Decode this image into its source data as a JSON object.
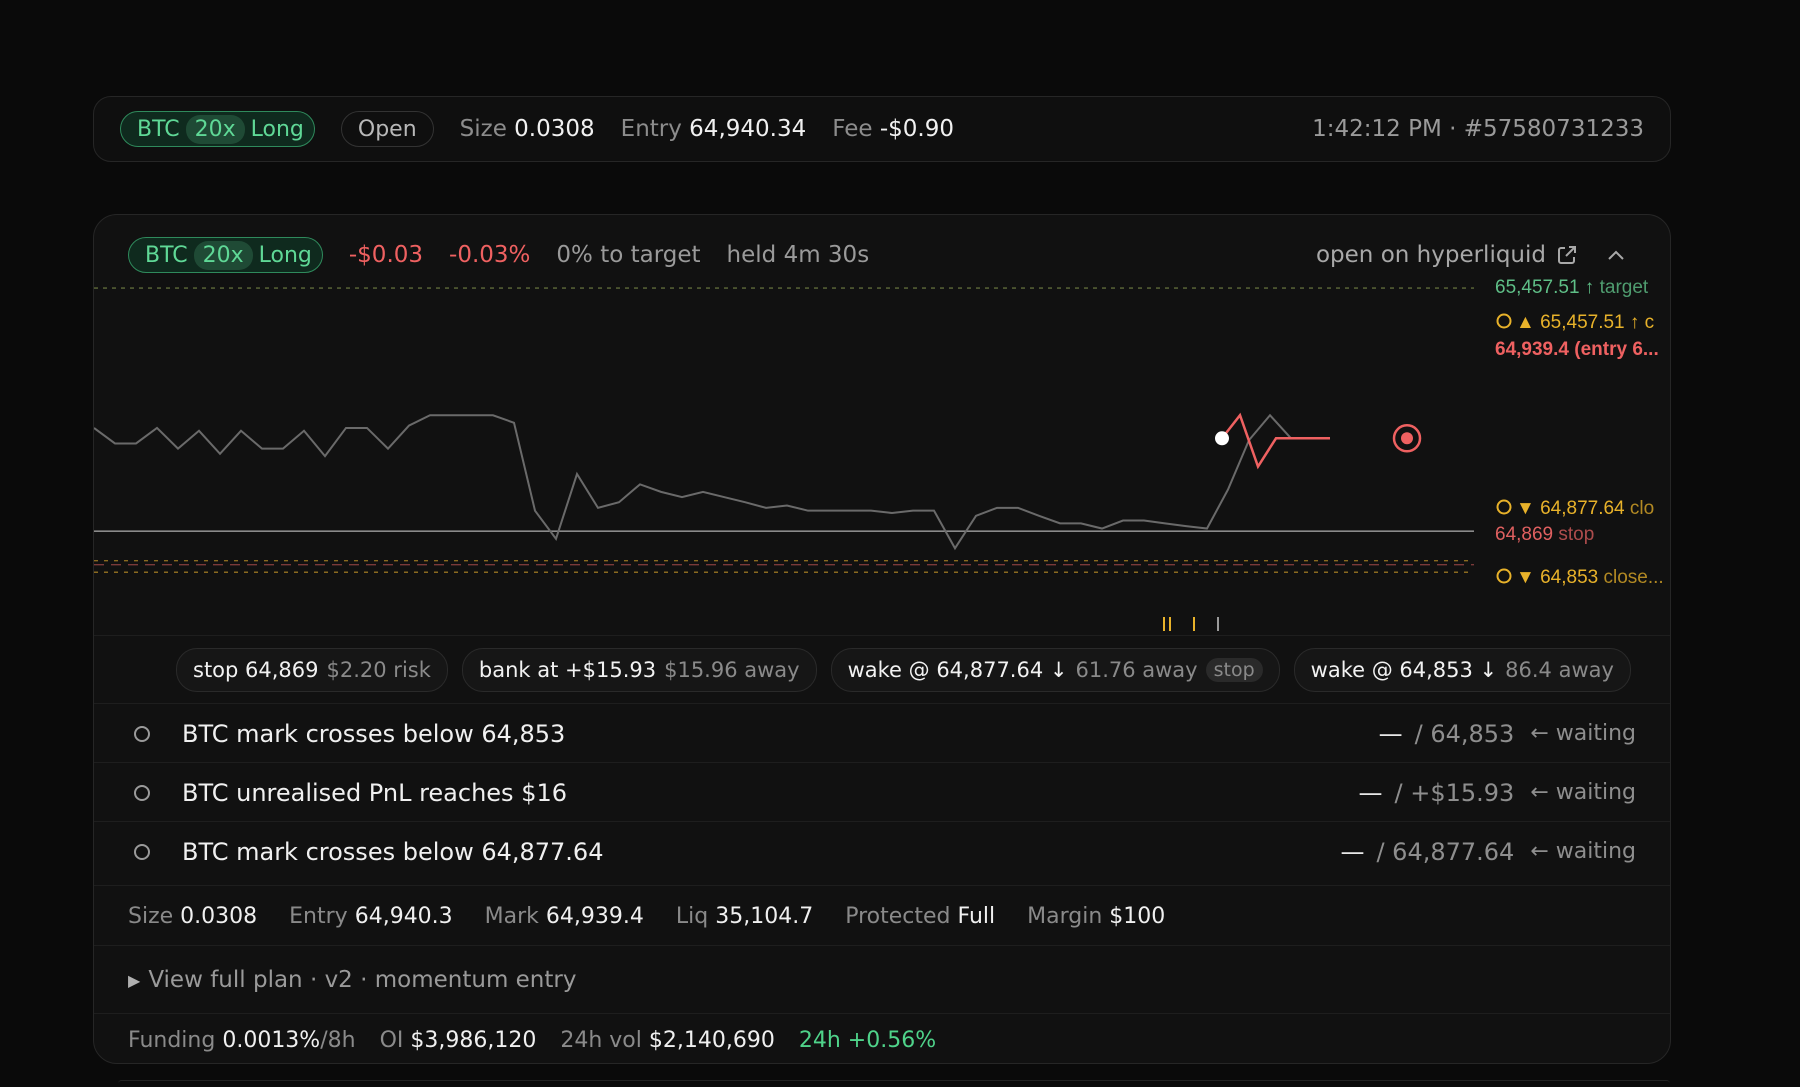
{
  "colors": {
    "long_green": "#5fd896",
    "loss_red": "#ef6161",
    "target_green": "#5fbf87",
    "alert_yellow": "#e8b22a",
    "stop_red": "#e06060",
    "price_line": "#6a6a6a"
  },
  "header": {
    "asset": "BTC",
    "leverage": "20x",
    "side": "Long",
    "status": "Open",
    "size_label": "Size",
    "size_value": "0.0308",
    "entry_label": "Entry",
    "entry_value": "64,940.34",
    "fee_label": "Fee",
    "fee_value": "-$0.90",
    "time_id": "1:42:12 PM · #57580731233"
  },
  "position": {
    "asset": "BTC",
    "leverage": "20x",
    "side": "Long",
    "pnl": "-$0.03",
    "pnl_pct": "-0.03%",
    "progress": "0% to target",
    "held": "held 4m 30s",
    "open_link": "open on hyperliquid",
    "external_icon": "external-link-icon",
    "collapse_icon": "chevron-up-icon"
  },
  "chart": {
    "labels": {
      "target_price": "65,457.51",
      "target_text": "target",
      "alert_up_price": "65,457.51",
      "entry_price": "64,939.4",
      "entry_text": "(entry 6...",
      "alert_down1_price": "64,877.64",
      "alert_down1_text": "clo",
      "stop_price": "64,869",
      "stop_text": "stop",
      "alert_down2_price": "64,853",
      "alert_down2_text": "close..."
    }
  },
  "chart_data": {
    "type": "line",
    "title": "",
    "xlabel": "",
    "ylabel": "",
    "ylim": [
      64845,
      65462
    ],
    "grid": false,
    "levels": [
      {
        "name": "target",
        "price": 65457.51
      },
      {
        "name": "alert up",
        "price": 65457.51
      },
      {
        "name": "entry",
        "price": 64940.34
      },
      {
        "name": "alert down",
        "price": 64877.64
      },
      {
        "name": "stop",
        "price": 64869
      },
      {
        "name": "alert down",
        "price": 64853
      }
    ],
    "series": [
      {
        "values": [
          65160,
          65127,
          65127,
          65160,
          65116,
          65154,
          65105,
          65154,
          65116,
          65116,
          65154,
          65100,
          65160,
          65160,
          65116,
          65165,
          65187,
          65187,
          65187,
          65187,
          65171,
          64984,
          64924,
          65062,
          64990,
          65002,
          65040,
          65024,
          65013,
          65024,
          65013,
          65002,
          64990,
          64995,
          64984,
          64984,
          64984,
          64984,
          64979,
          64984,
          64984,
          64904,
          64973,
          64990,
          64990,
          64973,
          64957,
          64957,
          64946,
          64963,
          64963,
          64957,
          64951,
          64946,
          65029,
          65134,
          65187,
          65138
        ]
      },
      {
        "values": [
          65138,
          65187,
          65078,
          65138,
          65138,
          65138,
          65138
        ]
      }
    ]
  },
  "triggers": [
    {
      "main": "stop 64,869",
      "sub": "$2.20 risk",
      "tag": ""
    },
    {
      "main": "bank at +$15.93",
      "sub": "$15.96 away",
      "tag": ""
    },
    {
      "main": "wake @ 64,877.64 ↓",
      "sub": "61.76 away",
      "tag": "stop"
    },
    {
      "main": "wake @ 64,853 ↓",
      "sub": "86.4 away",
      "tag": ""
    }
  ],
  "conditions": [
    {
      "text": "BTC mark crosses below 64,853",
      "current": "—",
      "target": "/ 64,853",
      "status": "← waiting"
    },
    {
      "text": "BTC unrealised PnL reaches $16",
      "current": "—",
      "target": "/ +$15.93",
      "status": "← waiting"
    },
    {
      "text": "BTC mark crosses below 64,877.64",
      "current": "—",
      "target": "/ 64,877.64",
      "status": "← waiting"
    }
  ],
  "stats": {
    "size_k": "Size",
    "size_v": "0.0308",
    "entry_k": "Entry",
    "entry_v": "64,940.3",
    "mark_k": "Mark",
    "mark_v": "64,939.4",
    "liq_k": "Liq",
    "liq_v": "35,104.7",
    "prot_k": "Protected",
    "prot_v": "Full",
    "margin_k": "Margin",
    "margin_v": "$100"
  },
  "plan": {
    "label": "View full plan · v2 · momentum entry"
  },
  "market": {
    "funding_k": "Funding",
    "funding_v": "0.0013%",
    "funding_u": "/8h",
    "oi_k": "OI",
    "oi_v": "$3,986,120",
    "vol_k": "24h vol",
    "vol_v": "$2,140,690",
    "change": "24h +0.56%"
  }
}
